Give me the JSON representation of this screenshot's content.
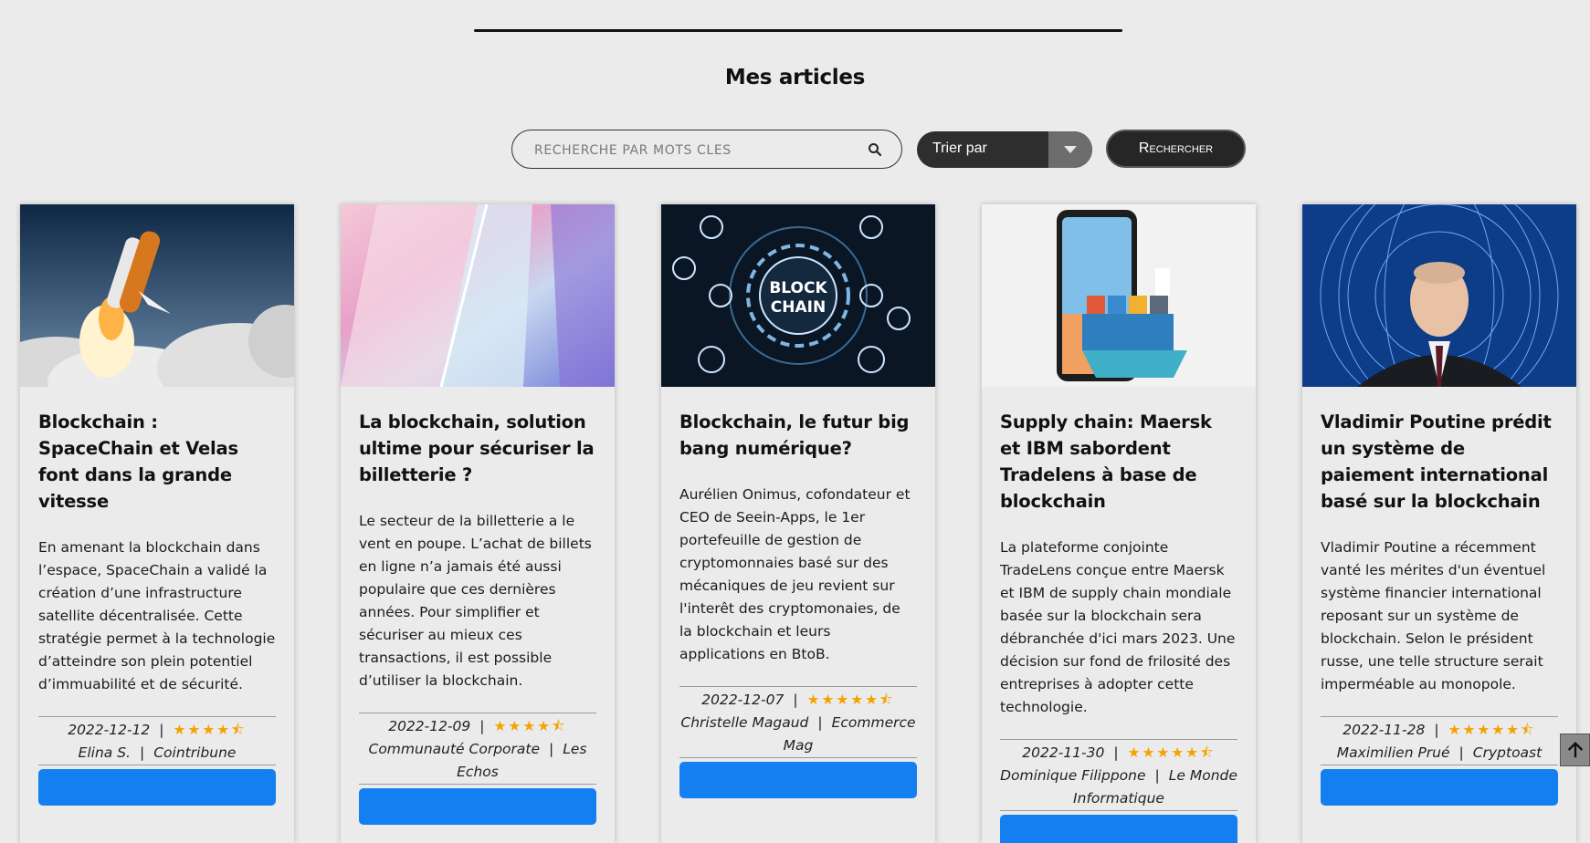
{
  "page": {
    "title": "Mes articles"
  },
  "search": {
    "placeholder": "RECHERCHE PAR MOTS CLES",
    "value": "",
    "icon": "search-icon",
    "sort_label": "Trier par",
    "button_label": "Rechercher"
  },
  "colors": {
    "background": "#ebebeb",
    "dark": "#2e2e2e",
    "accent_button": "#137ff0",
    "star": "#f5a100"
  },
  "articles": [
    {
      "title": "Blockchain : SpaceChain et Velas font dans la grande vitesse",
      "excerpt": "En amenant la blockchain dans l’espace, SpaceChain a validé la création d’une infrastructure satellite décentralisée. Cette stratégie permet à la technologie d’atteindre son plein potentiel d’immuabilité et de sécurité.",
      "date": "2022-12-12",
      "rating": 4.5,
      "stars": "★★★★⯪",
      "author": "Elina S.",
      "source": "Cointribune",
      "image": "rocket-launch-image"
    },
    {
      "title": "La blockchain, solution ultime pour sécuriser la billetterie ?",
      "excerpt": "Le secteur de la billetterie a le vent en poupe. L’achat de billets en ligne n’a jamais été aussi populaire que ces dernières années. Pour simplifier et sécuriser au mieux ces transactions, il est possible d’utiliser la blockchain.",
      "date": "2022-12-09",
      "rating": 4.5,
      "stars": "★★★★⯪",
      "author": "Communauté Corporate",
      "source": "Les Echos",
      "image": "glass-prism-image"
    },
    {
      "title": "Blockchain, le futur big bang numérique?",
      "excerpt": "Aurélien Onimus, cofondateur et CEO de Seein-Apps, le 1er portefeuille de gestion de cryptomonnaies basé sur des mécaniques de jeu revient sur l'interêt des cryptomonaies, de la blockchain et leurs applications en BtoB.",
      "date": "2022-12-07",
      "rating": 5.5,
      "stars": "★★★★★⯪",
      "author": "Christelle Magaud",
      "source": "Ecommerce Mag",
      "image": "block-chain-image",
      "image_text": [
        "BLOCK",
        "CHAIN"
      ]
    },
    {
      "title": "Supply chain: Maersk et IBM sabordent Tradelens à base de blockchain",
      "excerpt": "La plateforme conjointe TradeLens conçue entre Maersk et IBM de supply chain mondiale basée sur la blockchain sera débranchée d'ici mars 2023. Une décision sur fond de frilosité des entreprises à adopter cette technologie.",
      "date": "2022-11-30",
      "rating": 5.5,
      "stars": "★★★★★⯪",
      "author": "Dominique Filippone",
      "source": "Le Monde Informatique",
      "image": "phone-cargo-ship-image"
    },
    {
      "title": "Vladimir Poutine prédit un système de paiement international basé sur la blockchain",
      "excerpt": "Vladimir Poutine a récemment vanté les mérites d'un éventuel système financier international reposant sur un système de blockchain. Selon le président russe, une telle structure serait imperméable au monopole.",
      "date": "2022-11-28",
      "rating": 5.5,
      "stars": "★★★★★⯪",
      "author": "Maximilien Prué",
      "source": "Cryptoast",
      "image": "poutine-network-image"
    }
  ],
  "scroll_top": {
    "icon": "arrow-up-icon"
  }
}
